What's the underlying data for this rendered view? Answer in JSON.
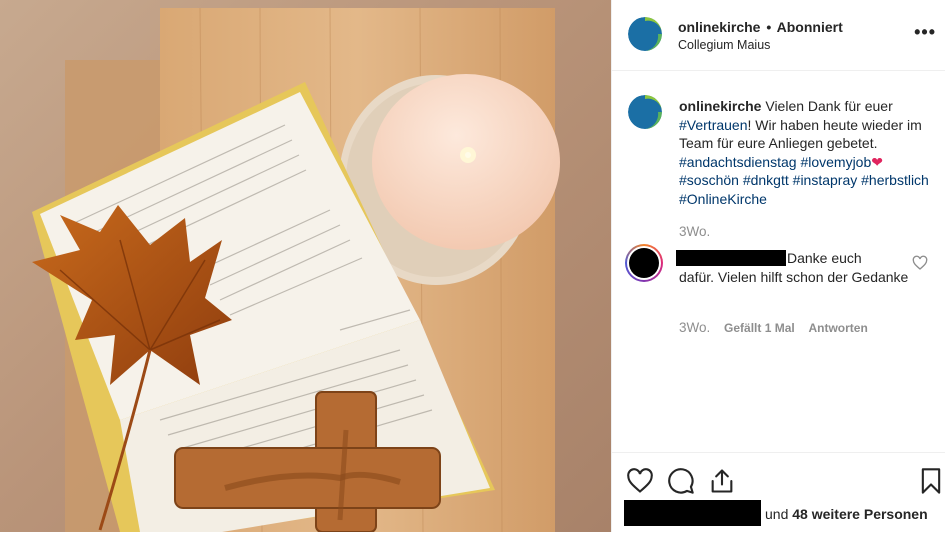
{
  "header": {
    "username": "onlinekirche",
    "separator": "•",
    "follow_status": "Abonniert",
    "location": "Collegium Maius",
    "more_label": "•••"
  },
  "caption": {
    "username": "onlinekirche",
    "text_1": "Vielen Dank für euer",
    "tag_vertrauen": "#Vertrauen",
    "text_2": "! Wir haben heute wieder im Team für eure Anliegen gebetet.",
    "tag_andachtsdienstag": "#andachtsdienstag",
    "tag_lovemyjob": "#lovemyjob",
    "heart": "❤",
    "tag_soschoen": "#soschön",
    "tag_dnkgtt": "#dnkgtt",
    "tag_instapray": "#instapray",
    "tag_herbstlich": "#herbstlich",
    "tag_onlinekirche": "#OnlineKirche",
    "timestamp": "3Wo."
  },
  "comment": {
    "text_line1": "Danke euch",
    "text_rest": "dafür. Vielen hilft schon der Gedanke",
    "timestamp": "3Wo.",
    "likes": "Gefällt 1 Mal",
    "reply": "Antworten"
  },
  "likes": {
    "prefix": "und",
    "count_text": "48 weitere Personen"
  },
  "icons": [
    "heart-icon",
    "comment-icon",
    "share-icon",
    "bookmark-icon",
    "more-icon"
  ],
  "colors": {
    "link": "#00376b",
    "muted": "#8e8e8e",
    "text": "#262626"
  }
}
